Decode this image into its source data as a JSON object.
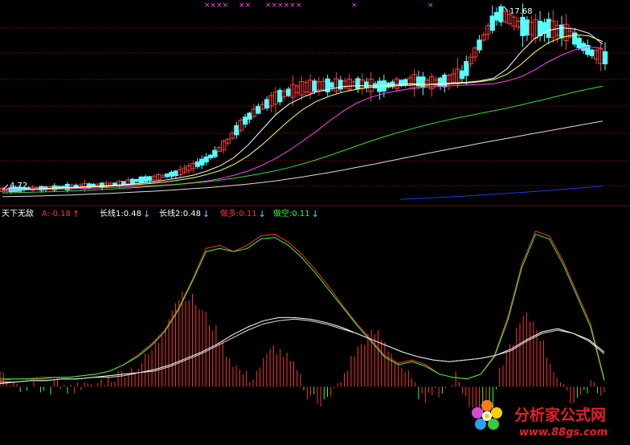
{
  "colors": {
    "background": "#000000",
    "grid": "#7a0000",
    "candle_up": "#ff3b3b",
    "candle_down": "#55ffff",
    "ma5": "#ffffff",
    "ma10": "#ffff66",
    "ma20": "#ff44ff",
    "ma60": "#33dd33",
    "ma120": "#dddddd",
    "ma250": "#2233ff",
    "label_white": "#ffffff",
    "label_red": "#ff3333",
    "label_green": "#33ff33",
    "label_cyan": "#66ccff",
    "markers": "#ff44ff"
  },
  "price_panel": {
    "high_label": "17.68",
    "low_label": "4.72",
    "top_markers": [
      "××××",
      "××",
      "×××××",
      "×",
      "×",
      "×"
    ]
  },
  "indicator_header": {
    "name": "天下无敌",
    "items": [
      {
        "label": "A:",
        "value": "-0.18",
        "arrow": "↑",
        "color": "#ff3333"
      },
      {
        "label": "长线1:",
        "value": "0.48",
        "arrow": "↓",
        "color": "#ffffff"
      },
      {
        "label": "长线2:",
        "value": "0.48",
        "arrow": "↓",
        "color": "#ffffff"
      },
      {
        "label": "做多:",
        "value": "0.11",
        "arrow": "↓",
        "color": "#ff3333"
      },
      {
        "label": "做空:",
        "value": "0.11",
        "arrow": "↓",
        "color": "#33ff33"
      }
    ]
  },
  "watermark": {
    "text": "分析家公式网",
    "url": "www.88gs.com"
  },
  "chart_data": [
    {
      "type": "candlestick",
      "title": "",
      "ylim": [
        3.8,
        18.4
      ],
      "grid": true,
      "price_path": [
        4.72,
        4.75,
        4.8,
        4.82,
        4.85,
        4.9,
        4.95,
        5.0,
        5.05,
        5.1,
        5.2,
        5.35,
        5.5,
        5.6,
        5.8,
        6.0,
        6.4,
        6.8,
        7.4,
        8.2,
        9.3,
        10.2,
        10.8,
        11.4,
        11.8,
        12.1,
        12.3,
        12.35,
        12.4,
        12.45,
        12.5,
        12.4,
        12.3,
        12.45,
        12.6,
        12.7,
        12.55,
        12.6,
        12.85,
        13.2,
        14.8,
        16.3,
        17.68,
        17.2,
        16.7,
        16.5,
        16.6,
        16.4,
        16.2,
        15.3,
        14.7,
        14.4
      ],
      "series": [
        {
          "name": "MA5",
          "values": [
            4.72,
            4.74,
            4.78,
            4.82,
            4.86,
            4.9,
            4.95,
            5.0,
            5.05,
            5.1,
            5.2,
            5.3,
            5.45,
            5.6,
            5.8,
            6.1,
            6.5,
            7.1,
            8.0,
            9.1,
            10.2,
            11.0,
            11.5,
            11.9,
            12.1,
            12.3,
            12.35,
            12.35,
            12.38,
            12.45,
            12.5,
            12.45,
            12.5,
            12.55,
            12.6,
            12.7,
            12.9,
            13.6,
            14.8,
            15.8,
            16.4,
            16.6,
            16.5,
            16.2,
            15.4
          ]
        },
        {
          "name": "MA10",
          "values": [
            4.72,
            4.73,
            4.76,
            4.8,
            4.83,
            4.87,
            4.92,
            4.96,
            5.0,
            5.05,
            5.12,
            5.2,
            5.3,
            5.45,
            5.6,
            5.85,
            6.15,
            6.6,
            7.2,
            8.0,
            8.9,
            9.8,
            10.6,
            11.2,
            11.6,
            11.9,
            12.1,
            12.25,
            12.3,
            12.35,
            12.4,
            12.45,
            12.45,
            12.5,
            12.55,
            12.65,
            12.8,
            13.2,
            13.9,
            14.8,
            15.5,
            15.9,
            16.1,
            16.0,
            15.6
          ]
        },
        {
          "name": "MA20",
          "values": [
            4.72,
            4.72,
            4.73,
            4.75,
            4.77,
            4.8,
            4.83,
            4.86,
            4.9,
            4.94,
            4.98,
            5.02,
            5.08,
            5.15,
            5.25,
            5.38,
            5.55,
            5.8,
            6.1,
            6.5,
            7.0,
            7.6,
            8.3,
            9.0,
            9.8,
            10.5,
            11.1,
            11.5,
            11.8,
            12.0,
            12.15,
            12.25,
            12.3,
            12.35,
            12.4,
            12.45,
            12.5,
            12.7,
            13.0,
            13.5,
            14.1,
            14.6,
            15.0,
            15.2,
            15.1
          ]
        },
        {
          "name": "MA60",
          "values": [
            4.5,
            4.52,
            4.54,
            4.57,
            4.6,
            4.64,
            4.68,
            4.73,
            4.78,
            4.84,
            4.9,
            4.97,
            5.05,
            5.13,
            5.22,
            5.32,
            5.44,
            5.58,
            5.74,
            5.92,
            6.12,
            6.35,
            6.62,
            6.92,
            7.25,
            7.6,
            7.95,
            8.3,
            8.62,
            8.92,
            9.2,
            9.46,
            9.7,
            9.92,
            10.12,
            10.32,
            10.52,
            10.72,
            10.94,
            11.18,
            11.42,
            11.66,
            11.9,
            12.12,
            12.32
          ]
        },
        {
          "name": "MA120",
          "values": [
            4.22,
            4.24,
            4.26,
            4.29,
            4.32,
            4.35,
            4.39,
            4.43,
            4.47,
            4.52,
            4.57,
            4.62,
            4.68,
            4.74,
            4.81,
            4.88,
            4.96,
            5.05,
            5.15,
            5.26,
            5.38,
            5.52,
            5.67,
            5.83,
            6.0,
            6.18,
            6.37,
            6.56,
            6.76,
            6.96,
            7.16,
            7.36,
            7.56,
            7.75,
            7.94,
            8.13,
            8.32,
            8.5,
            8.68,
            8.86,
            9.04,
            9.22,
            9.4,
            9.58,
            9.76
          ]
        },
        {
          "name": "MA250",
          "values": [
            4.02,
            4.08,
            4.14,
            4.2,
            4.26,
            4.33,
            4.4,
            4.47,
            4.55,
            4.63,
            4.72,
            4.81,
            4.9,
            5.0
          ]
        }
      ]
    },
    {
      "type": "line",
      "title": "天下无敌",
      "ylim": [
        -0.35,
        1.05
      ],
      "series": [
        {
          "name": "做多",
          "values": [
            0.04,
            0.05,
            0.05,
            0.06,
            0.06,
            0.06,
            0.07,
            0.08,
            0.1,
            0.14,
            0.2,
            0.27,
            0.36,
            0.5,
            0.68,
            0.88,
            0.9,
            0.86,
            0.9,
            0.96,
            0.97,
            0.92,
            0.84,
            0.74,
            0.63,
            0.51,
            0.4,
            0.3,
            0.2,
            0.15,
            0.17,
            0.14,
            0.08,
            0.06,
            0.05,
            0.08,
            0.2,
            0.45,
            0.78,
            0.99,
            0.96,
            0.8,
            0.6,
            0.4,
            0.05
          ]
        },
        {
          "name": "做空",
          "values": [
            0.05,
            0.05,
            0.05,
            0.05,
            0.06,
            0.06,
            0.07,
            0.08,
            0.1,
            0.14,
            0.19,
            0.26,
            0.35,
            0.49,
            0.67,
            0.86,
            0.88,
            0.86,
            0.88,
            0.94,
            0.95,
            0.9,
            0.82,
            0.72,
            0.61,
            0.5,
            0.39,
            0.29,
            0.19,
            0.14,
            0.16,
            0.13,
            0.08,
            0.06,
            0.05,
            0.08,
            0.19,
            0.43,
            0.76,
            0.97,
            0.94,
            0.78,
            0.58,
            0.38,
            0.04
          ]
        },
        {
          "name": "长线1",
          "values": [
            0.02,
            0.03,
            0.04,
            0.04,
            0.05,
            0.05,
            0.06,
            0.07,
            0.08,
            0.09,
            0.11,
            0.14,
            0.18,
            0.22,
            0.27,
            0.33,
            0.38,
            0.42,
            0.44,
            0.44,
            0.43,
            0.41,
            0.38,
            0.34,
            0.3,
            0.26,
            0.22,
            0.19,
            0.17,
            0.16,
            0.17,
            0.18,
            0.2,
            0.24,
            0.3,
            0.35,
            0.37,
            0.34,
            0.3,
            0.22
          ]
        },
        {
          "name": "长线2",
          "values": [
            0.03,
            0.03,
            0.04,
            0.04,
            0.05,
            0.05,
            0.06,
            0.06,
            0.07,
            0.09,
            0.1,
            0.13,
            0.17,
            0.21,
            0.26,
            0.31,
            0.36,
            0.4,
            0.42,
            0.43,
            0.42,
            0.4,
            0.37,
            0.34,
            0.3,
            0.26,
            0.22,
            0.19,
            0.17,
            0.16,
            0.17,
            0.18,
            0.2,
            0.23,
            0.29,
            0.34,
            0.36,
            0.34,
            0.29,
            0.21
          ]
        },
        {
          "name": "A",
          "values": [
            0.12,
            0.03,
            -0.02,
            0.0,
            -0.05,
            0.02,
            -0.03,
            0.01,
            -0.01,
            0.04,
            0.06,
            0.1,
            0.12,
            0.2,
            0.3,
            0.5,
            0.6,
            0.55,
            0.45,
            0.35,
            0.2,
            0.1,
            0.05,
            0.15,
            0.25,
            0.2,
            0.1,
            -0.05,
            -0.1,
            -0.08,
            0.05,
            0.2,
            0.3,
            0.35,
            0.25,
            0.15,
            0.05,
            -0.08,
            -0.05,
            -0.02,
            0.08,
            -0.1,
            -0.15,
            -0.2,
            0.15,
            0.3,
            0.45,
            0.4,
            0.2,
            0.05,
            -0.1,
            -0.05,
            0.03,
            -0.05
          ]
        }
      ]
    }
  ]
}
